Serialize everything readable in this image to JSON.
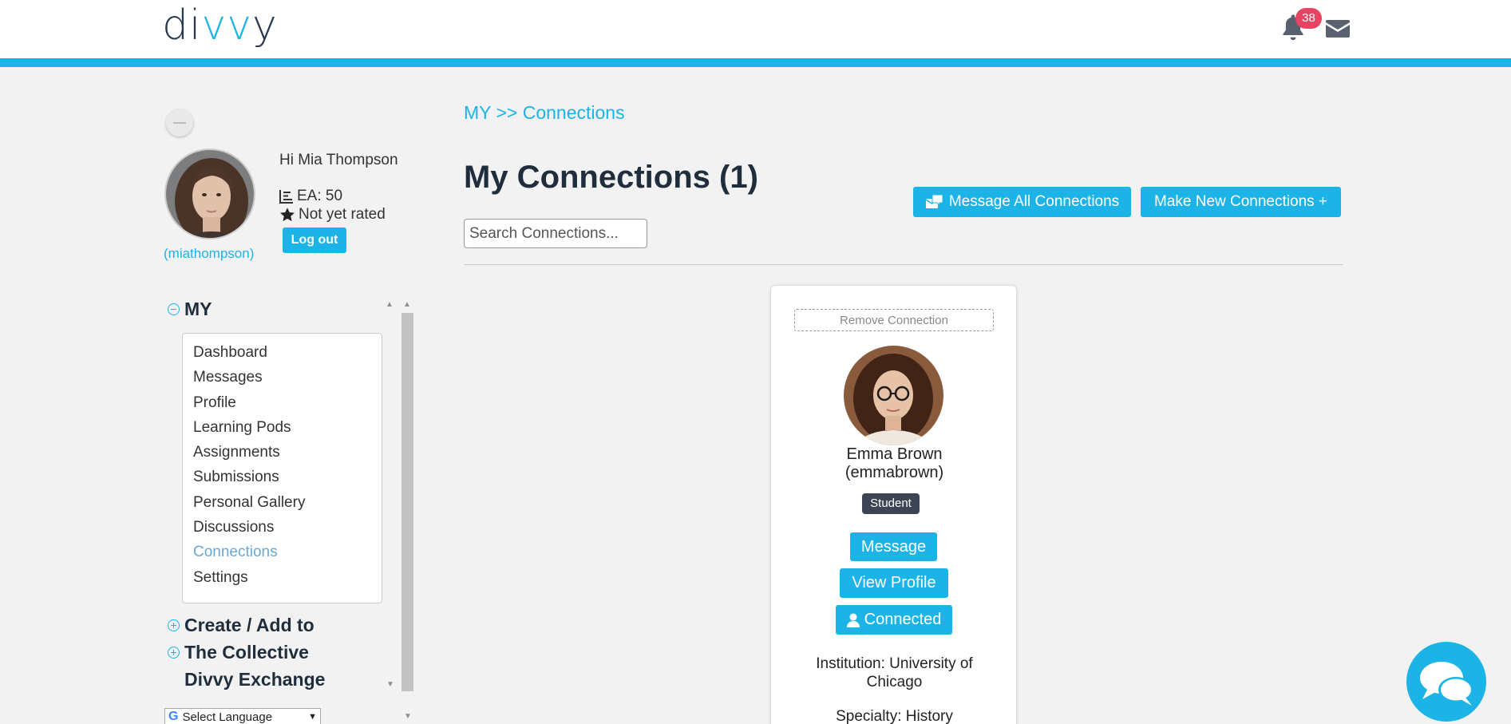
{
  "header": {
    "logo_prefix": "di",
    "logo_accent": "vv",
    "logo_suffix": "y",
    "notification_count": "38"
  },
  "profile": {
    "greeting": "Hi Mia Thompson",
    "ea": "EA: 50",
    "rating": "Not yet rated",
    "logout_label": "Log out",
    "username": "(miathompson)"
  },
  "menu": {
    "my_label": "MY",
    "items": [
      {
        "label": "Dashboard"
      },
      {
        "label": "Messages"
      },
      {
        "label": "Profile"
      },
      {
        "label": "Learning Pods"
      },
      {
        "label": "Assignments"
      },
      {
        "label": "Submissions"
      },
      {
        "label": "Personal Gallery"
      },
      {
        "label": "Discussions"
      },
      {
        "label": "Connections"
      },
      {
        "label": "Settings"
      }
    ],
    "create_label": "Create / Add to",
    "collective_label": "The Collective",
    "exchange_label": "Divvy Exchange",
    "language_label": "Select Language"
  },
  "main": {
    "breadcrumb": "MY >> Connections",
    "title": "My Connections (1)",
    "message_all_label": "Message All Connections",
    "make_new_label": "Make New Connections +",
    "search_placeholder": "Search Connections..."
  },
  "connection": {
    "remove_label": "Remove Connection",
    "name": "Emma Brown",
    "username": "(emmabrown)",
    "role": "Student",
    "message_label": "Message",
    "view_profile_label": "View Profile",
    "connected_label": "Connected",
    "institution_line1": "Institution: University of",
    "institution_line2": "Chicago",
    "specialty": "Specialty: History"
  },
  "colors": {
    "accent": "#1cb4e6",
    "badge": "#e84363",
    "role_badge": "#3d4453",
    "active_menu": "#6aa8d0"
  }
}
